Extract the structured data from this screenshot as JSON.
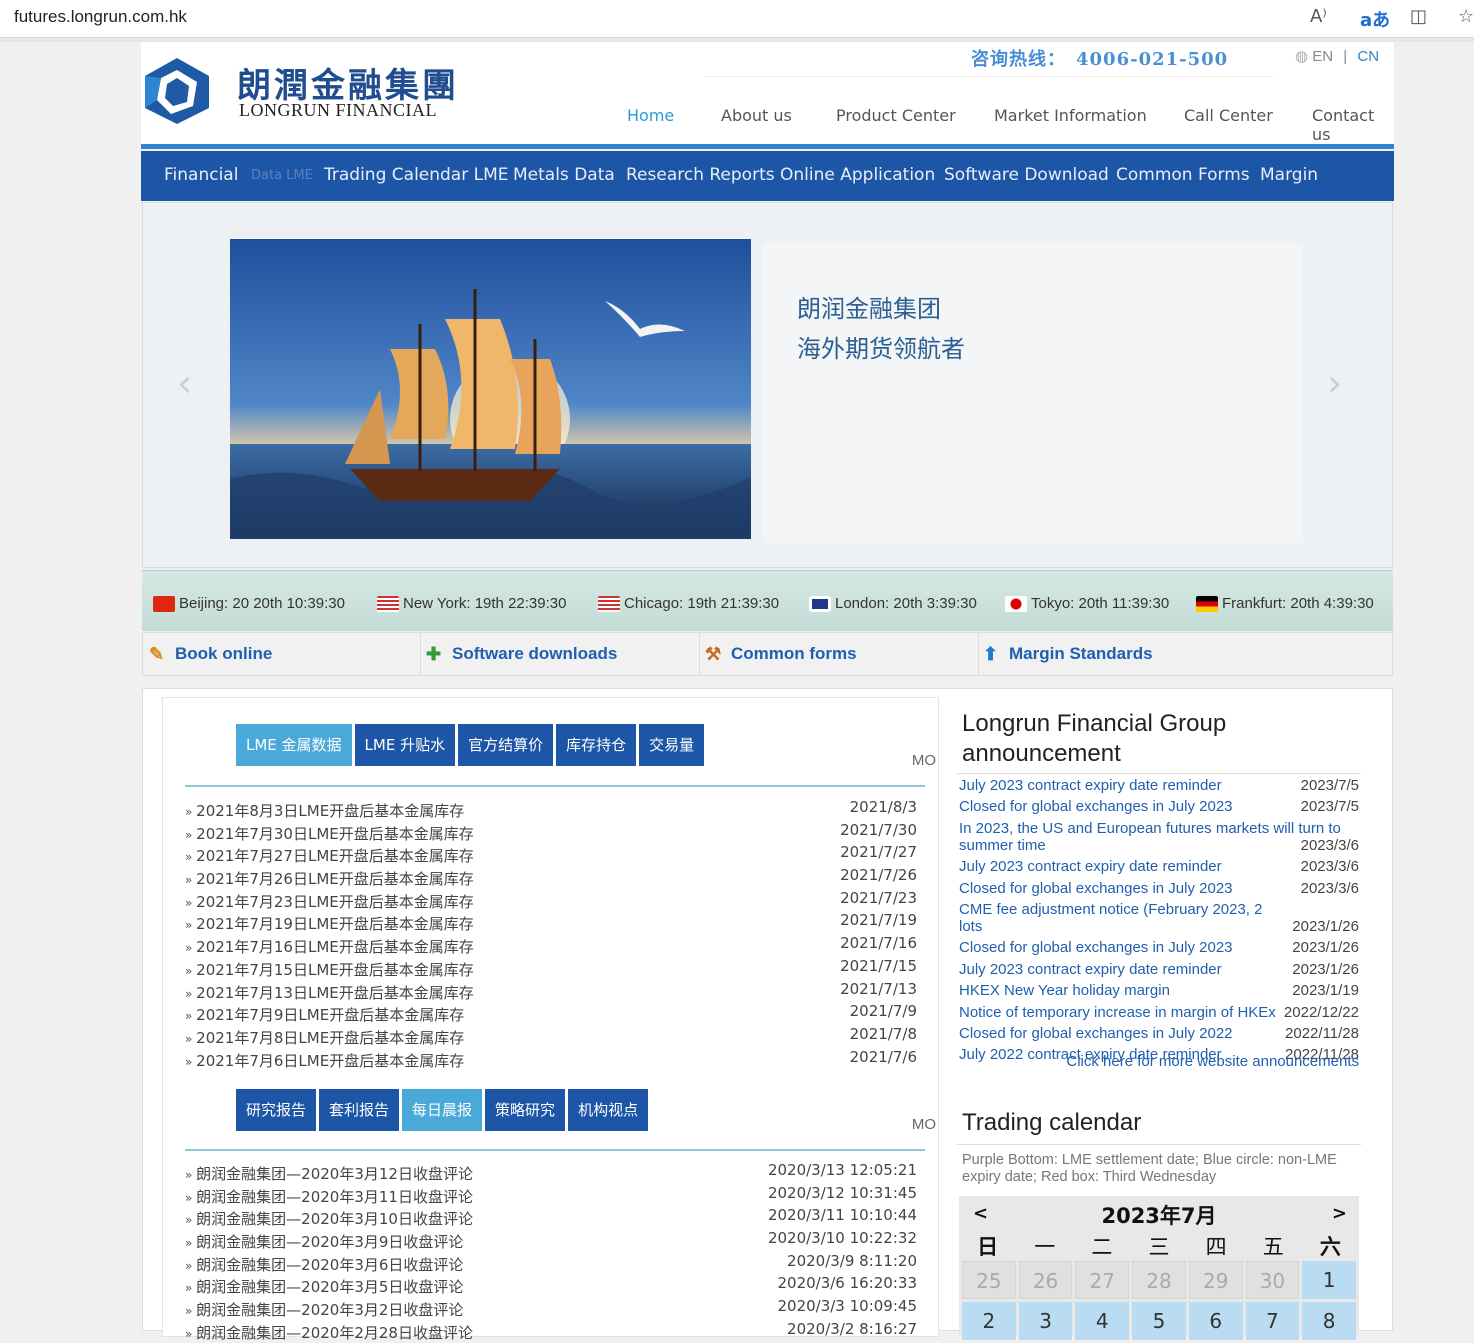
{
  "browser": {
    "url": "futures.longrun.com.hk"
  },
  "header": {
    "logo_cn": "朗潤金融集團",
    "logo_en": "LONGRUN FINANCIAL",
    "hotline": "咨询热线：　4006-021-500",
    "lang_en": "EN",
    "lang_sep": "|",
    "lang_cn": "CN",
    "nav": [
      "Home",
      "About us",
      "Product Center",
      "Market Information",
      "Call Center",
      "Contact us"
    ]
  },
  "subnav": {
    "items": [
      "Financial",
      "Data LME",
      "Trading Calendar LME",
      "Metals Data",
      "Research Reports",
      "Online Application",
      "Software Download",
      "Common Forms",
      "Margin"
    ]
  },
  "banner": {
    "slogan_line1": "朗润金融集团",
    "slogan_line2": "海外期货领航者",
    "prev": "‹",
    "next": "›"
  },
  "clocks": [
    {
      "label": "Beijing: 20 20th 10:39:30",
      "flag": "cn"
    },
    {
      "label": "New York: 19th 22:39:30",
      "flag": "us"
    },
    {
      "label": "Chicago: 19th 21:39:30",
      "flag": "us"
    },
    {
      "label": "London: 20th 3:39:30",
      "flag": "uk"
    },
    {
      "label": "Tokyo: 20th 11:39:30",
      "flag": "jp"
    },
    {
      "label": "Frankfurt: 20th 4:39:30",
      "flag": "de"
    }
  ],
  "quick": [
    "Book online",
    "Software downloads",
    "Common forms",
    "Margin Standards"
  ],
  "lme": {
    "tabs": [
      "LME 金属数据",
      "LME 升贴水",
      "官方结算价",
      "库存持仓",
      "交易量"
    ],
    "more": "MO",
    "rows": [
      {
        "title": "2021年8月3日LME开盘后基本金属库存",
        "date": "2021/8/3"
      },
      {
        "title": "2021年7月30日LME开盘后基本金属库存",
        "date": "2021/7/30"
      },
      {
        "title": "2021年7月27日LME开盘后基本金属库存",
        "date": "2021/7/27"
      },
      {
        "title": "2021年7月26日LME开盘后基本金属库存",
        "date": "2021/7/26"
      },
      {
        "title": "2021年7月23日LME开盘后基本金属库存",
        "date": "2021/7/23"
      },
      {
        "title": "2021年7月19日LME开盘后基本金属库存",
        "date": "2021/7/19"
      },
      {
        "title": "2021年7月16日LME开盘后基本金属库存",
        "date": "2021/7/16"
      },
      {
        "title": "2021年7月15日LME开盘后基本金属库存",
        "date": "2021/7/15"
      },
      {
        "title": "2021年7月13日LME开盘后基本金属库存",
        "date": "2021/7/13"
      },
      {
        "title": "2021年7月9日LME开盘后基本金属库存",
        "date": "2021/7/9"
      },
      {
        "title": "2021年7月8日LME开盘后基本金属库存",
        "date": "2021/7/8"
      },
      {
        "title": "2021年7月6日LME开盘后基本金属库存",
        "date": "2021/7/6"
      }
    ]
  },
  "research": {
    "tabs": [
      "研究报告",
      "套利报告",
      "每日晨报",
      "策略研究",
      "机构视点"
    ],
    "more": "MO",
    "rows": [
      {
        "title": "朗润金融集团—2020年3月12日收盘评论",
        "date": "2020/3/13 12:05:21"
      },
      {
        "title": "朗润金融集团—2020年3月11日收盘评论",
        "date": "2020/3/12 10:31:45"
      },
      {
        "title": "朗润金融集团—2020年3月10日收盘评论",
        "date": "2020/3/11 10:10:44"
      },
      {
        "title": "朗润金融集团—2020年3月9日收盘评论",
        "date": "2020/3/10 10:22:32"
      },
      {
        "title": "朗润金融集团—2020年3月6日收盘评论",
        "date": "2020/3/9 8:11:20"
      },
      {
        "title": "朗润金融集团—2020年3月5日收盘评论",
        "date": "2020/3/6 16:20:33"
      },
      {
        "title": "朗润金融集团—2020年3月2日收盘评论",
        "date": "2020/3/3 10:09:45"
      },
      {
        "title": "朗润金融集团—2020年2月28日收盘评论",
        "date": "2020/3/2 8:16:27"
      }
    ]
  },
  "announcements": {
    "title_line1": "Longrun Financial Group",
    "title_line2": "announcement",
    "items": [
      {
        "title": "July 2023 contract expiry date reminder",
        "date": "2023/7/5"
      },
      {
        "title": "Closed for global exchanges in July 2023",
        "date": "2023/7/5"
      },
      {
        "title": "In 2023, the US and European futures markets will turn to summer time",
        "date": "2023/3/6"
      },
      {
        "title": "July 2023 contract expiry date reminder",
        "date": "2023/3/6"
      },
      {
        "title": "Closed for global exchanges in July 2023",
        "date": "2023/3/6"
      },
      {
        "title": "CME fee adjustment notice (February 2023, 2 lots",
        "date": "2023/1/26"
      },
      {
        "title": "Closed for global exchanges in July 2023",
        "date": "2023/1/26"
      },
      {
        "title": "July 2023 contract expiry date reminder",
        "date": "2023/1/26"
      },
      {
        "title": "HKEX New Year holiday margin",
        "date": "2023/1/19"
      },
      {
        "title": "Notice of temporary increase in margin of HKEx",
        "date": "2022/12/22"
      },
      {
        "title": "Closed for global exchanges in July 2022",
        "date": "2022/11/28"
      },
      {
        "title": "July 2022 contract expiry date reminder",
        "date": "2022/11/28"
      }
    ],
    "more": "Click here for more website announcements"
  },
  "calendar": {
    "title": "Trading calendar",
    "note": "Purple Bottom: LME settlement date; Blue circle: non-LME expiry date; Red box: Third Wednesday",
    "prev": "<",
    "next": ">",
    "month": "2023年7月",
    "weekdays": [
      "日",
      "一",
      "二",
      "三",
      "四",
      "五",
      "六"
    ],
    "days": [
      {
        "d": "25",
        "cur": false
      },
      {
        "d": "26",
        "cur": false
      },
      {
        "d": "27",
        "cur": false
      },
      {
        "d": "28",
        "cur": false
      },
      {
        "d": "29",
        "cur": false
      },
      {
        "d": "30",
        "cur": false
      },
      {
        "d": "1",
        "cur": true
      },
      {
        "d": "2",
        "cur": true
      },
      {
        "d": "3",
        "cur": true
      },
      {
        "d": "4",
        "cur": true
      },
      {
        "d": "5",
        "cur": true
      },
      {
        "d": "6",
        "cur": true
      },
      {
        "d": "7",
        "cur": true
      },
      {
        "d": "8",
        "cur": true
      }
    ]
  }
}
